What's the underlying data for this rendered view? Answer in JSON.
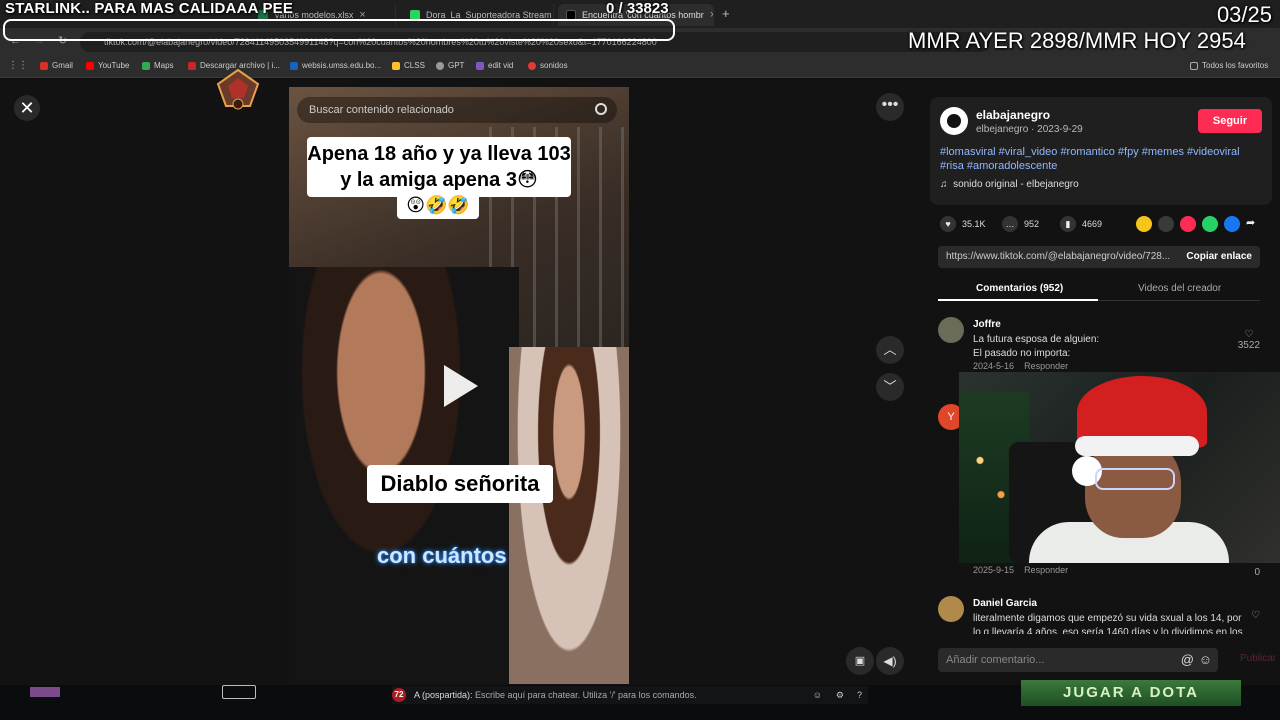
{
  "overlay": {
    "title": "STARLINK.. PARA MAS CALIDAAA PEE",
    "counter": "0  / 33823",
    "date": "03/25",
    "mmr": "MMR AYER 2898/MMR HOY 2954"
  },
  "browser": {
    "tabs": [
      {
        "label": "Varios modelos.xlsx"
      },
      {
        "label": "Dora_La_Suporteadora Stream"
      },
      {
        "label": "Encuentra 'con cuantos hombr"
      }
    ],
    "url": "tiktok.com/@elabajanegro/video/7284114950354991148?q=con%20cuantos%20hombres%20tu%20viste%20%20sexo&t=1770166224800",
    "bookmarks": [
      "Gmail",
      "YouTube",
      "Maps",
      "Descargar archivo | i...",
      "websis.umss.edu.bo...",
      "CLSS",
      "GPT",
      "edit vid",
      "sonidos"
    ],
    "all_bookmarks": "Todos los favoritos"
  },
  "video": {
    "search_placeholder": "Buscar contenido relacionado",
    "caption1": "Apena 18 año  y ya lleva 103 y la amiga apena 3😳",
    "caption1b": "😲🤣🤣",
    "caption2": "Diablo señorita",
    "caption3": "con cuántos"
  },
  "author": {
    "username": "elabajanegro",
    "subline": "elbejanegro · 2023-9-29",
    "follow": "Seguir",
    "hashtags": "#lomasviral #viral_video #romantico #fpy #memes #videoviral #risa #amoradolescente",
    "sound": "sonido original - elbejanegro"
  },
  "stats": {
    "likes": "35.1K",
    "comments": "952",
    "saves": "4669"
  },
  "link": {
    "url": "https://www.tiktok.com/@elabajanegro/video/728...",
    "copy": "Copiar enlace"
  },
  "tabs": {
    "comments": "Comentarios (952)",
    "creator": "Videos del creador"
  },
  "comments": [
    {
      "name": "Joffre",
      "text": "La futura esposa de alguien:\nEl pasado no importa:",
      "date": "2024-5-16",
      "reply": "Responder",
      "likes": "3522"
    },
    {
      "name": "",
      "text": "",
      "date": "2025-9-15",
      "reply": "Responder",
      "likes": "0"
    },
    {
      "name": "Daniel Garcia",
      "text": "literalmente digamos que empezó su vida sxual a los 14, por lo q llevaría 4 años, eso sería 1460 días y lo dividimos en los",
      "date": "",
      "reply": "",
      "likes": ""
    }
  ],
  "comment_input": {
    "placeholder": "Añadir comentario...",
    "publish": "Publicar"
  },
  "game": {
    "chat_level": "72",
    "chat_who": "A (pospartida):",
    "chat_hint": "Escribe aquí para chatear. Utiliza '/' para los comandos.",
    "play_button": "JUGAR A DOTA"
  },
  "colors": {
    "accent": "#fe2c55",
    "hashtag": "#8fb8ff",
    "background": "#121212"
  }
}
